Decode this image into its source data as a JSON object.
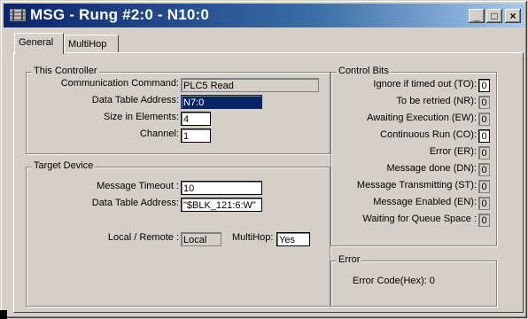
{
  "window": {
    "title": "MSG - Rung #2:0 - N10:0",
    "minimize_glyph": "_",
    "maximize_glyph": "□",
    "close_glyph": "×"
  },
  "tabs": [
    {
      "label": "General",
      "active": true
    },
    {
      "label": "MultiHop",
      "active": false
    }
  ],
  "this_controller": {
    "title": "This Controller",
    "communication_command_label": "Communication Command:",
    "communication_command_value": "PLC5 Read",
    "data_table_address_label": "Data Table Address:",
    "data_table_address_value": "N7:0",
    "size_label": "Size in Elements:",
    "size_value": "4",
    "channel_label": "Channel:",
    "channel_value": "1"
  },
  "target_device": {
    "title": "Target Device",
    "timeout_label": "Message Timeout :",
    "timeout_value": "10",
    "address_label": "Data Table Address:",
    "address_value": "\"$BLK_121:6:W\"",
    "local_remote_label": "Local / Remote :",
    "local_remote_value": "Local",
    "multihop_label": "MultiHop:",
    "multihop_value": "Yes"
  },
  "control_bits": {
    "title": "Control Bits",
    "items": [
      {
        "label": "Ignore if timed out (TO):",
        "value": "0",
        "editable": true
      },
      {
        "label": "To be retried (NR):",
        "value": "0",
        "editable": false
      },
      {
        "label": "Awaiting Execution (EW):",
        "value": "0",
        "editable": false
      },
      {
        "label": "Continuous Run (CO):",
        "value": "0",
        "editable": true
      },
      {
        "label": "Error (ER):",
        "value": "0",
        "editable": false
      },
      {
        "label": "Message done (DN):",
        "value": "0",
        "editable": false
      },
      {
        "label": "Message Transmitting (ST):",
        "value": "0",
        "editable": false
      },
      {
        "label": "Message Enabled (EN):",
        "value": "0",
        "editable": false
      },
      {
        "label": "Waiting for Queue Space :",
        "value": "0",
        "editable": false
      }
    ]
  },
  "error": {
    "title": "Error",
    "code_label": "Error Code(Hex): 0"
  },
  "colors": {
    "titlebar_start": "#0a246a",
    "titlebar_end": "#a6caf0",
    "face": "#d4d0c8",
    "selection": "#0a246a"
  }
}
